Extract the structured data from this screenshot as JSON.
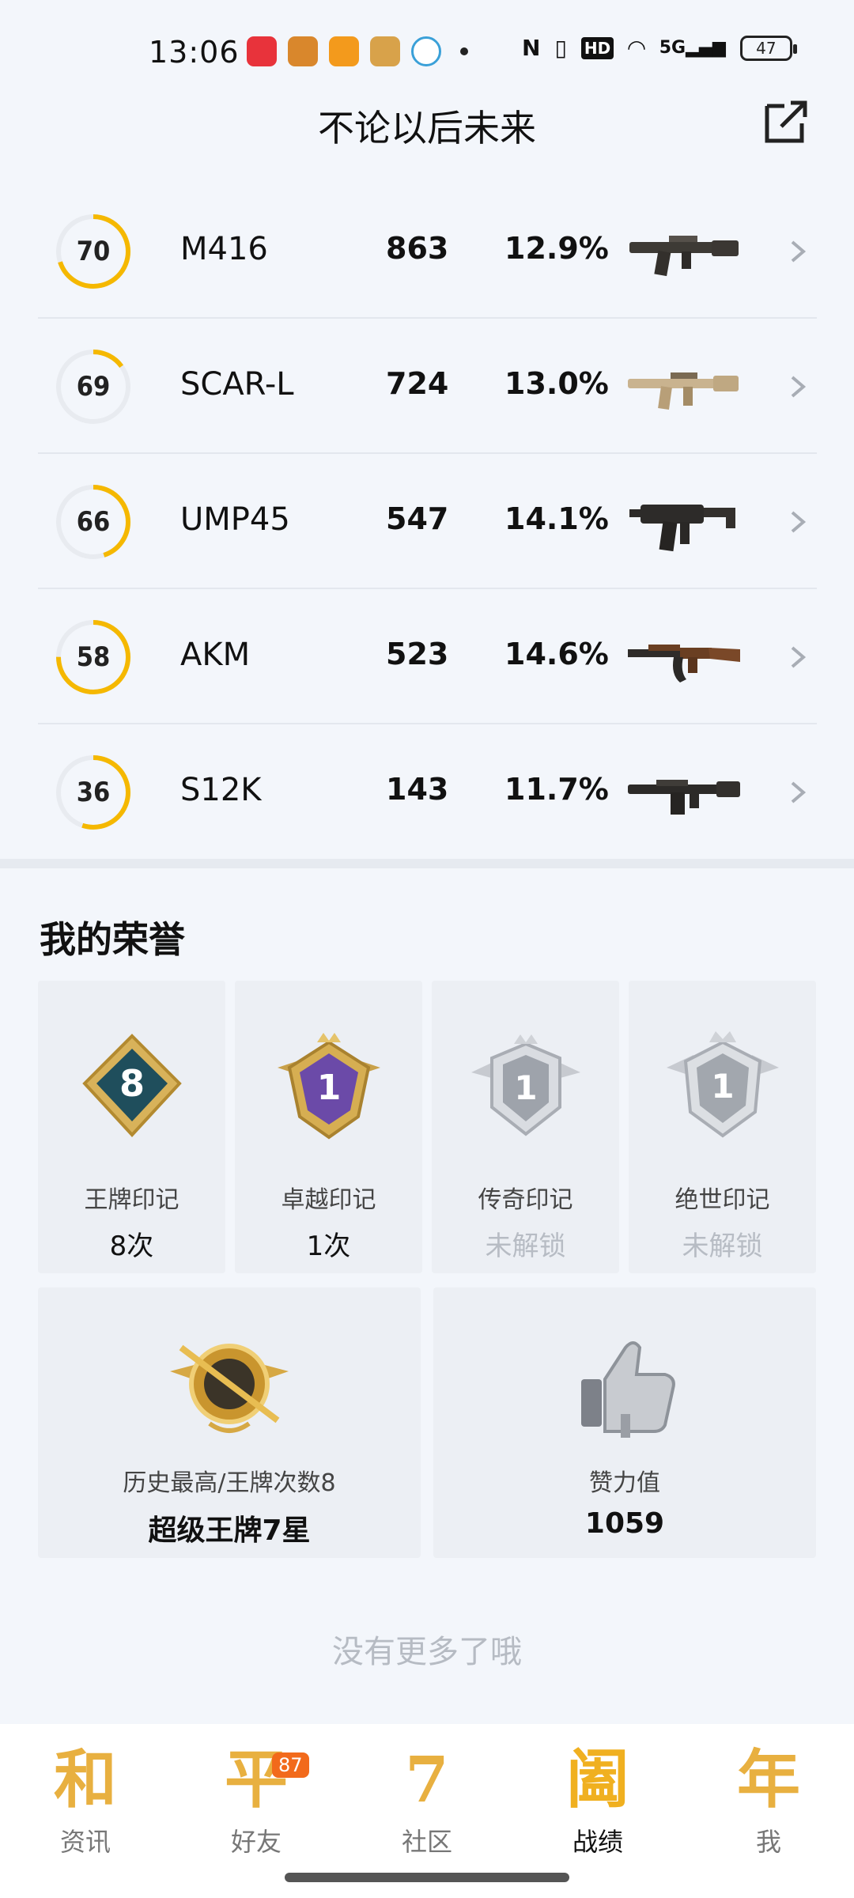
{
  "status_bar": {
    "time": "13:06",
    "network": "5G",
    "hd": "HD",
    "battery": "47"
  },
  "header": {
    "title": "不论以后未来"
  },
  "weapons": [
    {
      "score": "70",
      "name": "M416",
      "kills": "863",
      "rate": "12.9%",
      "progress": 0.7
    },
    {
      "score": "69",
      "name": "SCAR-L",
      "kills": "724",
      "rate": "13.0%",
      "progress": 0.15
    },
    {
      "score": "66",
      "name": "UMP45",
      "kills": "547",
      "rate": "14.1%",
      "progress": 0.45
    },
    {
      "score": "58",
      "name": "AKM",
      "kills": "523",
      "rate": "14.6%",
      "progress": 0.75
    },
    {
      "score": "36",
      "name": "S12K",
      "kills": "143",
      "rate": "11.7%",
      "progress": 0.55
    }
  ],
  "honors": {
    "title": "我的荣誉",
    "badges": [
      {
        "label": "王牌印记",
        "value": "8次",
        "locked": false,
        "number": "8"
      },
      {
        "label": "卓越印记",
        "value": "1次",
        "locked": false,
        "number": "1"
      },
      {
        "label": "传奇印记",
        "value": "未解锁",
        "locked": true,
        "number": "1"
      },
      {
        "label": "绝世印记",
        "value": "未解锁",
        "locked": true,
        "number": "1"
      }
    ],
    "highest": {
      "label": "历史最高/王牌次数8",
      "value": "超级王牌7星"
    },
    "likes": {
      "label": "赞力值",
      "value": "1059"
    }
  },
  "no_more": "没有更多了哦",
  "bottom_nav": [
    {
      "glyph": "和",
      "label": "资讯",
      "active": false
    },
    {
      "glyph": "平",
      "label": "好友",
      "active": false,
      "badge": "87"
    },
    {
      "glyph": "7",
      "label": "社区",
      "active": false
    },
    {
      "glyph": "阖",
      "label": "战绩",
      "active": true
    },
    {
      "glyph": "年",
      "label": "我",
      "active": false
    }
  ],
  "colors": {
    "accent": "#f5b800",
    "ring_track": "#e8ebf0",
    "badge_orange": "#f26a1b"
  }
}
